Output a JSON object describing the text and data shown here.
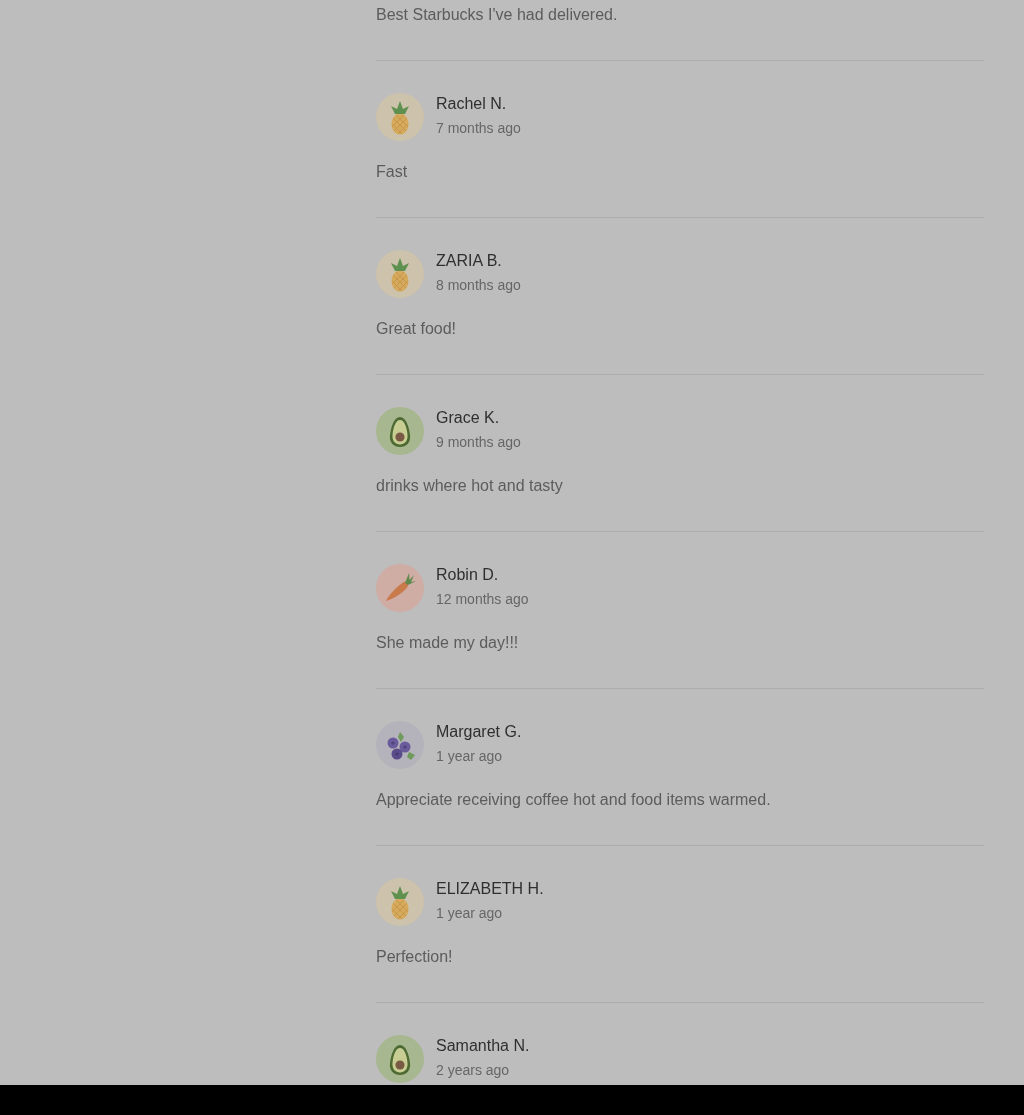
{
  "reviews": [
    {
      "text": "Best Starbucks I've had delivered."
    },
    {
      "kind": "pineapple",
      "name": "Rachel N.",
      "time": "7 months ago",
      "text": "Fast"
    },
    {
      "kind": "pineapple",
      "name": "ZARIA B.",
      "time": "8 months ago",
      "text": "Great food!"
    },
    {
      "kind": "avocado",
      "name": "Grace K.",
      "time": "9 months ago",
      "text": "drinks where hot and tasty"
    },
    {
      "kind": "carrot",
      "name": "Robin D.",
      "time": "12 months ago",
      "text": "She made my day!!!"
    },
    {
      "kind": "blueberry",
      "name": "Margaret G.",
      "time": "1 year ago",
      "text": "Appreciate receiving coffee hot and food items warmed."
    },
    {
      "kind": "pineapple",
      "name": "ELIZABETH H.",
      "time": "1 year ago",
      "text": "Perfection!"
    },
    {
      "kind": "avocado",
      "name": "Samantha N.",
      "time": "2 years ago"
    }
  ]
}
